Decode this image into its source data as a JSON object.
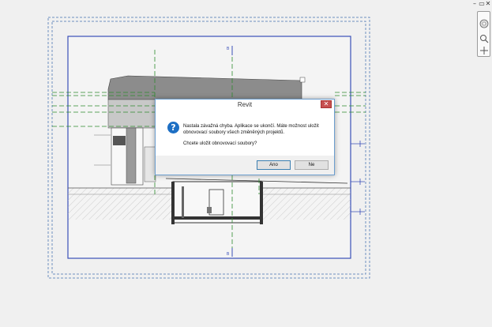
{
  "dialog": {
    "title": "Revit",
    "close": "✕",
    "message_line1": "Nastala závažná chyba. Aplikace se ukončí. Máte možnost uložit",
    "message_line2": "obnovovací soubory všech změněných projektů.",
    "question": "Chcete uložit obnovovací soubory?",
    "yes_label": "Ano",
    "no_label": "Ne",
    "icon": "question-icon"
  },
  "window_controls": {
    "restore": "▭",
    "close": "✕",
    "minimize": "–"
  },
  "navbar": {
    "icons": [
      "steering-wheel-icon",
      "zoom-icon",
      "pan-icon"
    ]
  },
  "drawing": {
    "section_marker_top": "B",
    "section_marker_bottom": "B",
    "colors": {
      "crop_region": "#3a4fb8",
      "grid_line": "#2d8a2d",
      "dashed_border": "#6e8fc0"
    }
  }
}
